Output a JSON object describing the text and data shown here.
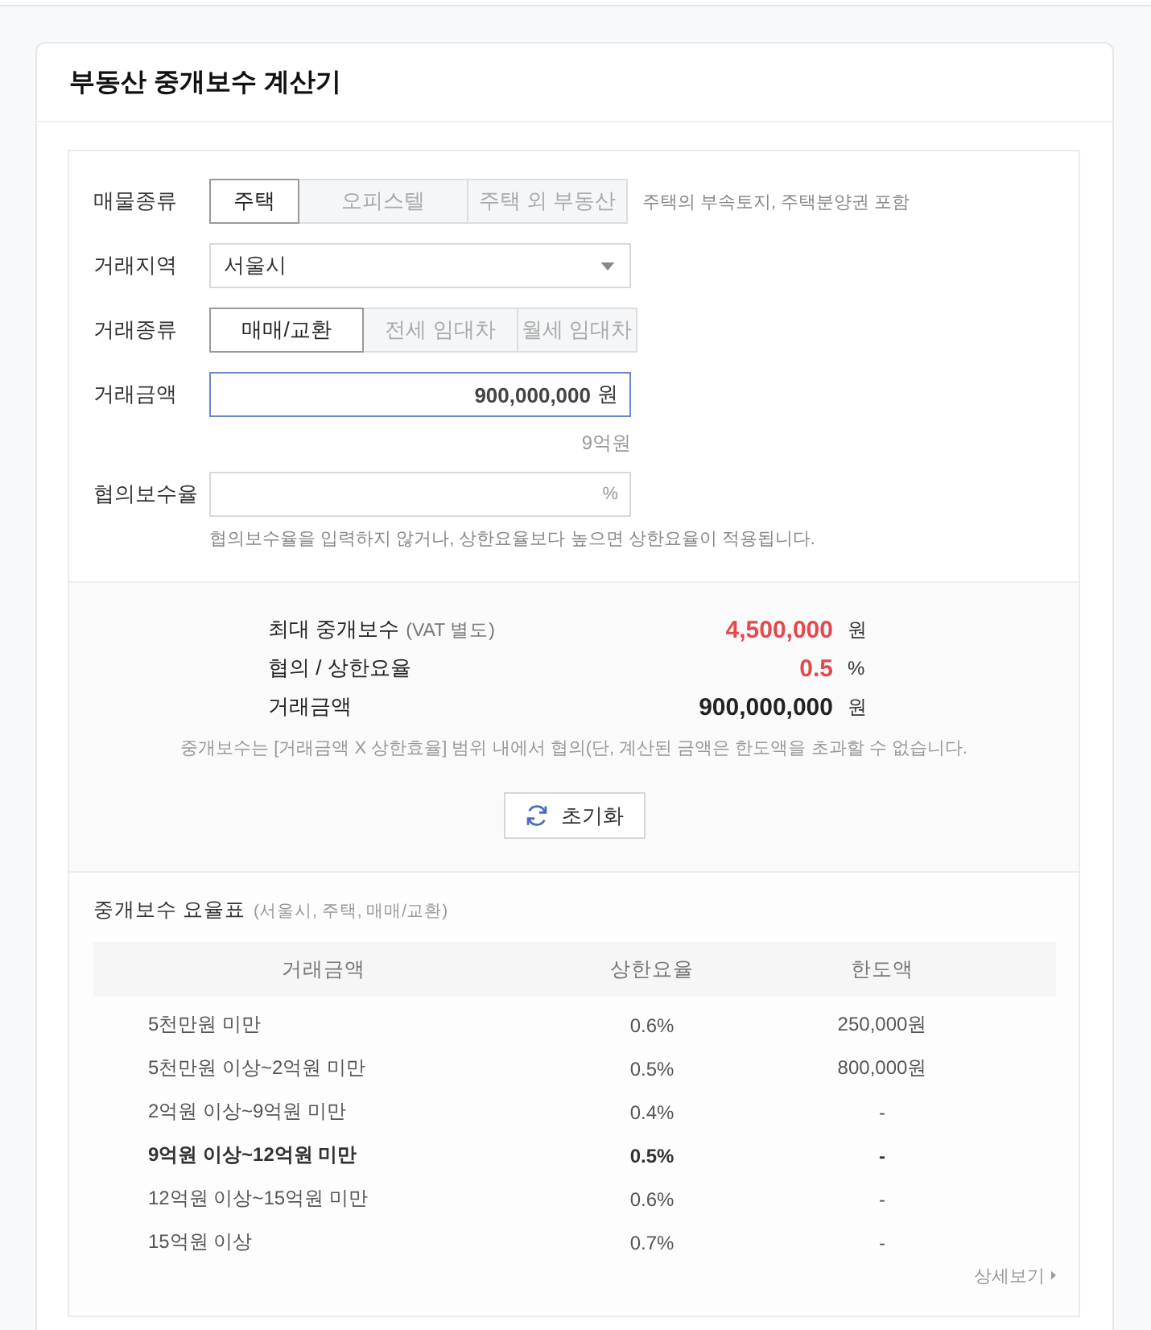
{
  "title": "부동산 중개보수 계산기",
  "form": {
    "property_type": {
      "label": "매물종류",
      "options": [
        {
          "label": "주택",
          "selected": true
        },
        {
          "label": "오피스텔",
          "selected": false
        },
        {
          "label": "주택 외 부동산",
          "selected": false
        }
      ],
      "note": "주택의 부속토지, 주택분양권 포함"
    },
    "region": {
      "label": "거래지역",
      "value": "서울시"
    },
    "deal_type": {
      "label": "거래종류",
      "options": [
        {
          "label": "매매/교환",
          "selected": true
        },
        {
          "label": "전세 임대차",
          "selected": false
        },
        {
          "label": "월세 임대차",
          "selected": false
        }
      ]
    },
    "amount": {
      "label": "거래금액",
      "value": "900,000,000",
      "unit": "원",
      "focused": true,
      "reading": "9억원"
    },
    "rate": {
      "label": "협의보수율",
      "unit": "%",
      "focused": false,
      "hint": "협의보수율을 입력하지 않거나, 상한요율보다 높으면 상한요율이 적용됩니다."
    }
  },
  "result": {
    "rows": [
      {
        "label": "최대 중개보수",
        "sublabel": "(VAT 별도)",
        "value": "4,500,000",
        "unit": "원",
        "color": "#e5484d"
      },
      {
        "label": "협의 / 상한요율",
        "value": "0.5",
        "unit": "%",
        "color": "#e5484d"
      },
      {
        "label": "거래금액",
        "value": "900,000,000",
        "unit": "원",
        "color": "#222222"
      }
    ],
    "note": "중개보수는 [거래금액 X 상한효율] 범위 내에서 협의(단, 계산된 금액은 한도액을 초과할 수 없습니다.",
    "reset_button": "초기화"
  },
  "rate_table": {
    "title": "중개보수 요율표",
    "subtitle": "(서울시, 주택, 매매/교환)",
    "columns": [
      "거래금액",
      "상한요율",
      "한도액"
    ],
    "rows": [
      {
        "cells": [
          "5천만원 미만",
          "0.6%",
          "250,000원"
        ],
        "applied": false
      },
      {
        "cells": [
          "5천만원 이상~2억원 미만",
          "0.5%",
          "800,000원"
        ],
        "applied": false
      },
      {
        "cells": [
          "2억원 이상~9억원 미만",
          "0.4%",
          "-"
        ],
        "applied": false
      },
      {
        "cells": [
          "9억원 이상~12억원 미만",
          "0.5%",
          "-"
        ],
        "applied": true
      },
      {
        "cells": [
          "12억원 이상~15억원 미만",
          "0.6%",
          "-"
        ],
        "applied": false
      },
      {
        "cells": [
          "15억원 이상",
          "0.7%",
          "-"
        ],
        "applied": false
      }
    ],
    "more_link": "상세보기"
  }
}
